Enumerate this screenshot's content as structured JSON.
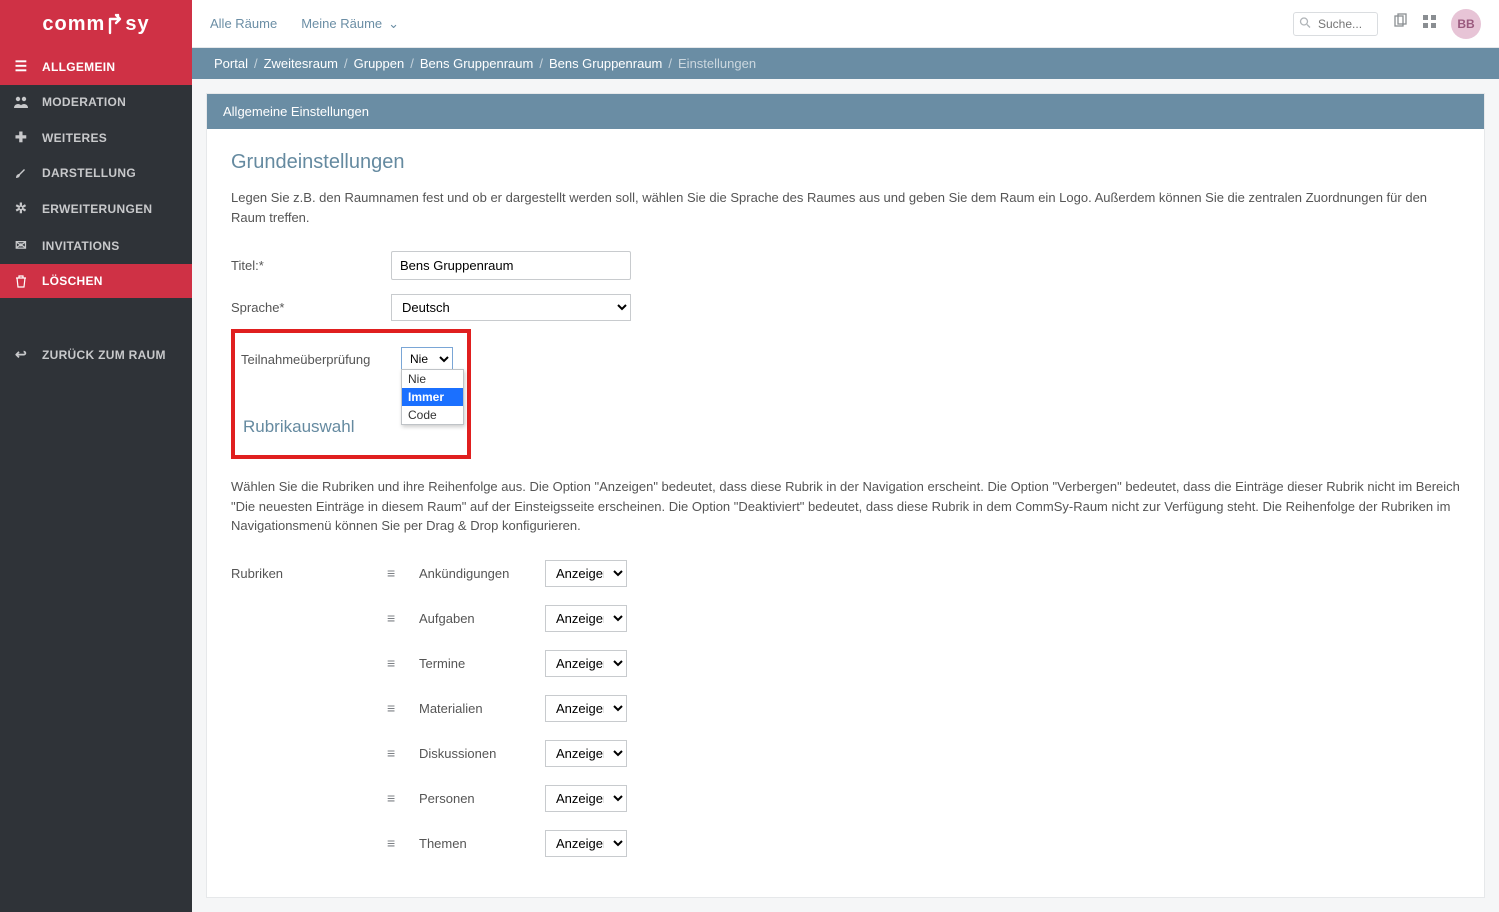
{
  "logo": "commSsy",
  "sidebar": {
    "items": [
      {
        "label": "ALLGEMEIN"
      },
      {
        "label": "MODERATION"
      },
      {
        "label": "WEITERES"
      },
      {
        "label": "DARSTELLUNG"
      },
      {
        "label": "ERWEITERUNGEN"
      },
      {
        "label": "INVITATIONS"
      },
      {
        "label": "LÖSCHEN"
      }
    ],
    "back": "ZURÜCK ZUM RAUM"
  },
  "topbar": {
    "all_rooms": "Alle Räume",
    "my_rooms": "Meine Räume",
    "search_placeholder": "Suche...",
    "avatar": "BB"
  },
  "breadcrumb": {
    "items": [
      "Portal",
      "Zweitesraum",
      "Gruppen",
      "Bens Gruppenraum",
      "Bens Gruppenraum"
    ],
    "current": "Einstellungen"
  },
  "panel": {
    "header": "Allgemeine Einstellungen",
    "grund": {
      "title": "Grundeinstellungen",
      "desc": "Legen Sie z.B. den Raumnamen fest und ob er dargestellt werden soll, wählen Sie die Sprache des Raumes aus und geben Sie dem Raum ein Logo. Außerdem können Sie die zentralen Zuordnungen für den Raum treffen.",
      "titel_label": "Titel:*",
      "titel_value": "Bens Gruppenraum",
      "sprache_label": "Sprache*",
      "sprache_value": "Deutsch",
      "teilnahme_label": "Teilnahmeüberprüfung",
      "teilnahme_value": "Nie",
      "teilnahme_options": [
        "Nie",
        "Immer",
        "Code"
      ]
    },
    "rubrik": {
      "title": "Rubrikauswahl",
      "desc": "Wählen Sie die Rubriken und ihre Reihenfolge aus. Die Option \"Anzeigen\" bedeutet, dass diese Rubrik in der Navigation erscheint. Die Option \"Verbergen\" bedeutet, dass die Einträge dieser Rubrik nicht im Bereich \"Die neuesten Einträge in diesem Raum\" auf der Einsteigsseite erscheinen. Die Option \"Deaktiviert\" bedeutet, dass diese Rubrik in dem CommSy-Raum nicht zur Verfügung steht. Die Reihenfolge der Rubriken im Navigationsmenü können Sie per Drag & Drop konfigurieren.",
      "label": "Rubriken",
      "items": [
        {
          "name": "Ankündigungen",
          "value": "Anzeigen"
        },
        {
          "name": "Aufgaben",
          "value": "Anzeigen"
        },
        {
          "name": "Termine",
          "value": "Anzeigen"
        },
        {
          "name": "Materialien",
          "value": "Anzeigen"
        },
        {
          "name": "Diskussionen",
          "value": "Anzeigen"
        },
        {
          "name": "Personen",
          "value": "Anzeigen"
        },
        {
          "name": "Themen",
          "value": "Anzeigen"
        }
      ]
    }
  }
}
